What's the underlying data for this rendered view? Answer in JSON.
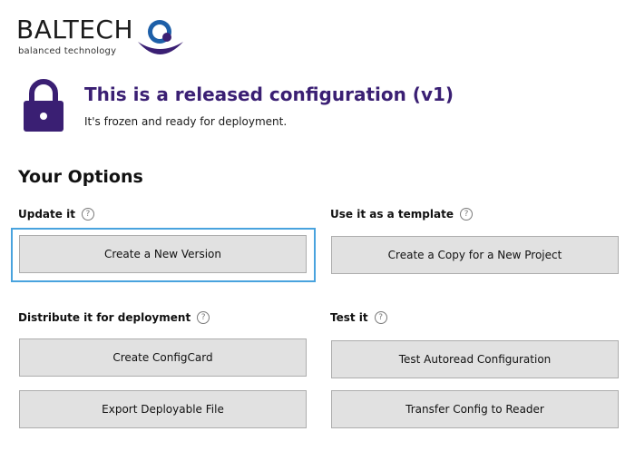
{
  "logo": {
    "wordmark": "BALTECH",
    "tagline": "balanced technology",
    "colors": {
      "ring": "#1d5fa8",
      "dot": "#3a1f73"
    }
  },
  "header": {
    "icon": "lock-icon",
    "title": "This is a released configuration (v1)",
    "subtitle": "It's frozen and ready for deployment.",
    "accent_color": "#3a1f73"
  },
  "options": {
    "heading": "Your Options",
    "help_glyph": "?",
    "update": {
      "label": "Update it",
      "buttons": {
        "new_version": "Create a New Version"
      }
    },
    "template": {
      "label": "Use it as a template",
      "buttons": {
        "copy_project": "Create a Copy for a New Project"
      }
    },
    "distribute": {
      "label": "Distribute it for deployment",
      "buttons": {
        "config_card": "Create ConfigCard",
        "export_file": "Export Deployable File"
      }
    },
    "test": {
      "label": "Test it",
      "buttons": {
        "test_autoread": "Test Autoread Configuration",
        "transfer": "Transfer Config to Reader"
      }
    }
  },
  "focus_color": "#49a3de"
}
